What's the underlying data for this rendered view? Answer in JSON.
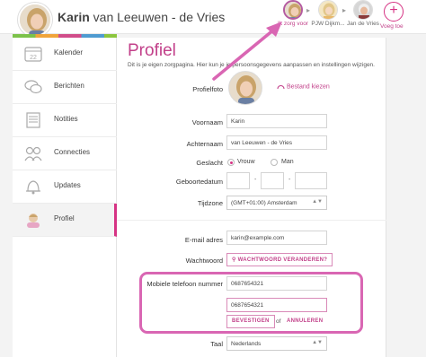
{
  "header": {
    "user_first": "Karin",
    "user_last": " van Leeuwen - de Vries",
    "people": [
      {
        "label": "Ik zorg voor",
        "active": true
      },
      {
        "label": "PJW Dijkm...",
        "active": false
      },
      {
        "label": "Jan de Vries",
        "active": false
      }
    ],
    "add_label": "Voeg toe",
    "add_symbol": "+"
  },
  "sidebar": {
    "items": [
      {
        "label": "Kalender",
        "icon": "calendar-icon"
      },
      {
        "label": "Berichten",
        "icon": "chat-icon"
      },
      {
        "label": "Notities",
        "icon": "notes-icon"
      },
      {
        "label": "Connecties",
        "icon": "connections-icon"
      },
      {
        "label": "Updates",
        "icon": "bell-icon"
      },
      {
        "label": "Profiel",
        "icon": "profile-icon",
        "active": true
      }
    ]
  },
  "main": {
    "title": "Profiel",
    "description": "Dit is je eigen zorgpagina. Hier kun je je persoonsgegevens aanpassen en instellingen wijzigen.",
    "profile_photo_label": "Profielfoto",
    "choose_file": "Bestand kiezen",
    "first_name_label": "Voornaam",
    "first_name_value": "Karin",
    "last_name_label": "Achternaam",
    "last_name_value": "van Leeuwen - de Vries",
    "gender_label": "Geslacht",
    "gender_female": "Vrouw",
    "gender_male": "Man",
    "birthdate_label": "Geboortedatum",
    "date_separator": "-",
    "timezone_label": "Tijdzone",
    "timezone_value": "(GMT+01:00) Amsterdam",
    "email_label": "E-mail adres",
    "email_value": "karin@example.com",
    "password_label": "Wachtwoord",
    "password_button": "WACHTWOORD VERANDEREN?",
    "mobile_label": "Mobiele telefoon nummer",
    "mobile_value": "0687654321",
    "mobile_confirm_value": "0687654321",
    "confirm_button": "BEVESTIGEN",
    "or_text": "of",
    "cancel_link": "ANNULEREN",
    "language_label": "Taal",
    "language_value": "Nederlands"
  },
  "colors": {
    "accent": "#c2418a",
    "highlight": "#d966b3"
  }
}
